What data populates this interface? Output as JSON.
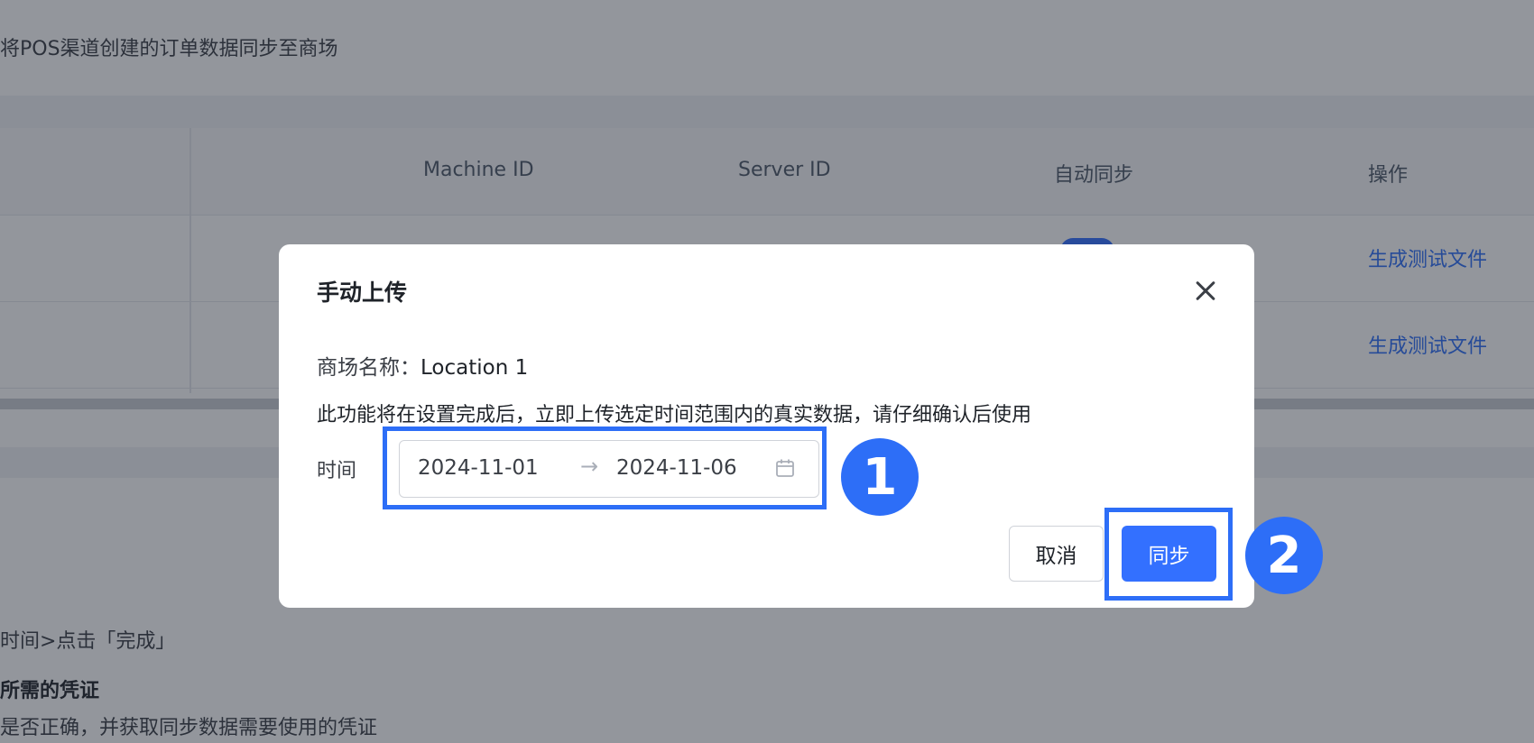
{
  "background": {
    "description": "将POS渠道创建的订单数据同步至商场",
    "table": {
      "headers": [
        "Machine ID",
        "Server ID",
        "自动同步",
        "操作"
      ],
      "rows": [
        {
          "action": "生成测试文件"
        },
        {
          "action": "生成测试文件"
        }
      ]
    },
    "steps": {
      "line1": "时间>点击「完成」",
      "line2": "所需的凭证",
      "line3": "是否正确，并获取同步数据需要使用的凭证"
    }
  },
  "modal": {
    "title": "手动上传",
    "store_label": "商场名称：",
    "store_value": "Location 1",
    "warning": "此功能将在设置完成后，立即上传选定时间范围内的真实数据，请仔细确认后使用",
    "time_label": "时间",
    "date_range": {
      "start": "2024-11-01",
      "separator": "→",
      "end": "2024-11-06"
    },
    "cancel_label": "取消",
    "sync_label": "同步"
  },
  "annotations": {
    "badge_1": "1",
    "badge_2": "2",
    "color": "#2d6ef7"
  },
  "colors": {
    "primary": "#3370ff",
    "link": "#2f6ff7"
  },
  "icons": {
    "close": "close-icon",
    "calendar": "calendar-icon"
  }
}
